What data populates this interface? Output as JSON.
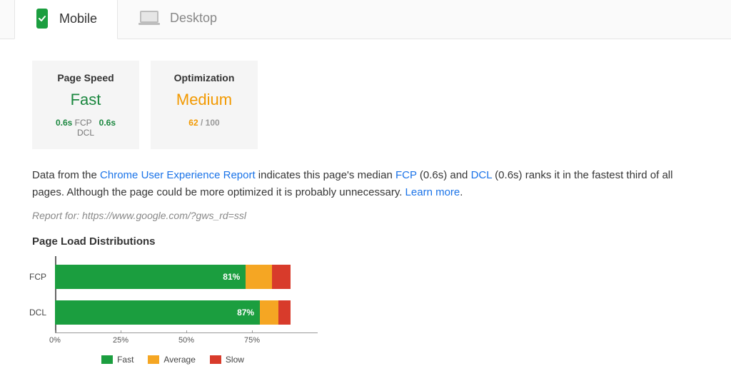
{
  "tabs": {
    "mobile": {
      "label": "Mobile",
      "active": true
    },
    "desktop": {
      "label": "Desktop",
      "active": false
    }
  },
  "cards": {
    "speed": {
      "title": "Page Speed",
      "value": "Fast",
      "fcp_value": "0.6s",
      "fcp_label": "FCP",
      "dcl_value": "0.6s",
      "dcl_label": "DCL"
    },
    "optimization": {
      "title": "Optimization",
      "value": "Medium",
      "score": "62",
      "score_suffix": " / 100"
    }
  },
  "description": {
    "prefix": "Data from the ",
    "link1": "Chrome User Experience Report",
    "mid1": " indicates this page's median ",
    "fcp_link": "FCP",
    "fcp_paren": " (0.6s) and ",
    "dcl_link": "DCL",
    "mid2": " (0.6s) ranks it in the fastest third of all pages. Although the page could be more optimized it is probably unnecessary. ",
    "learn_more": "Learn more",
    "period": "."
  },
  "report_for": "Report for: https://www.google.com/?gws_rd=ssl",
  "section_title": "Page Load Distributions",
  "legend": {
    "fast": "Fast",
    "average": "Average",
    "slow": "Slow"
  },
  "chart_data": {
    "type": "bar",
    "stacked": true,
    "orientation": "horizontal",
    "categories": [
      "FCP",
      "DCL"
    ],
    "series": [
      {
        "name": "Fast",
        "color": "#1b9e3f",
        "values": [
          81,
          87
        ]
      },
      {
        "name": "Average",
        "color": "#f5a623",
        "values": [
          11,
          8
        ]
      },
      {
        "name": "Slow",
        "color": "#d83b2b",
        "values": [
          8,
          5
        ]
      }
    ],
    "value_labels": [
      "81%",
      "87%"
    ],
    "x_ticks": [
      "0%",
      "25%",
      "50%",
      "75%"
    ],
    "xlim": [
      0,
      100
    ],
    "title": "Page Load Distributions",
    "ylabel": "",
    "xlabel": ""
  }
}
